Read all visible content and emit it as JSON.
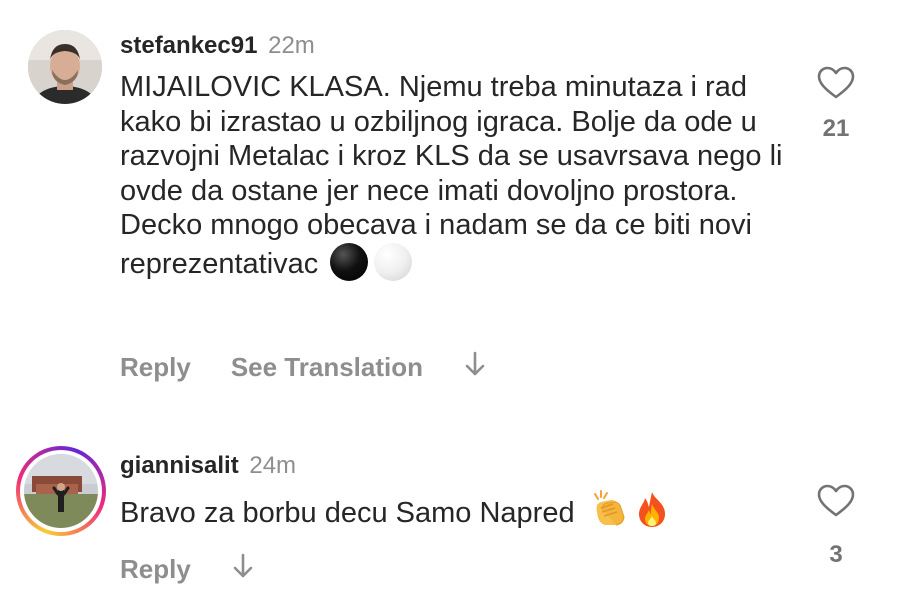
{
  "comments": [
    {
      "username": "stefankec91",
      "time": "22m",
      "text": "MIJAILOVIC KLASA. Njemu treba minutaza i rad kako bi izrastao u ozbiljnog igraca. Bolje da ode u razvojni Metalac i kroz KLS da se usavrsava nego li ovde da ostane jer nece imati dovoljno prostora. Decko mnogo obecava i nadam se da ce biti novi reprezentativac",
      "emoji": [
        "black-circle-emoji",
        "white-circle-emoji"
      ],
      "reply_label": "Reply",
      "translate_label": "See Translation",
      "like_count": "21"
    },
    {
      "username": "giannisalit",
      "time": "24m",
      "text": "Bravo za borbu decu Samo Napred",
      "emoji": [
        "clapping-hands-emoji",
        "fire-emoji"
      ],
      "reply_label": "Reply",
      "like_count": "3"
    }
  ],
  "colors": {
    "text": "#262626",
    "secondary": "#8e8e8e",
    "story_ring_start": "#f9ce34",
    "story_ring_mid": "#ee2a7b",
    "story_ring_end": "#6228d7"
  }
}
